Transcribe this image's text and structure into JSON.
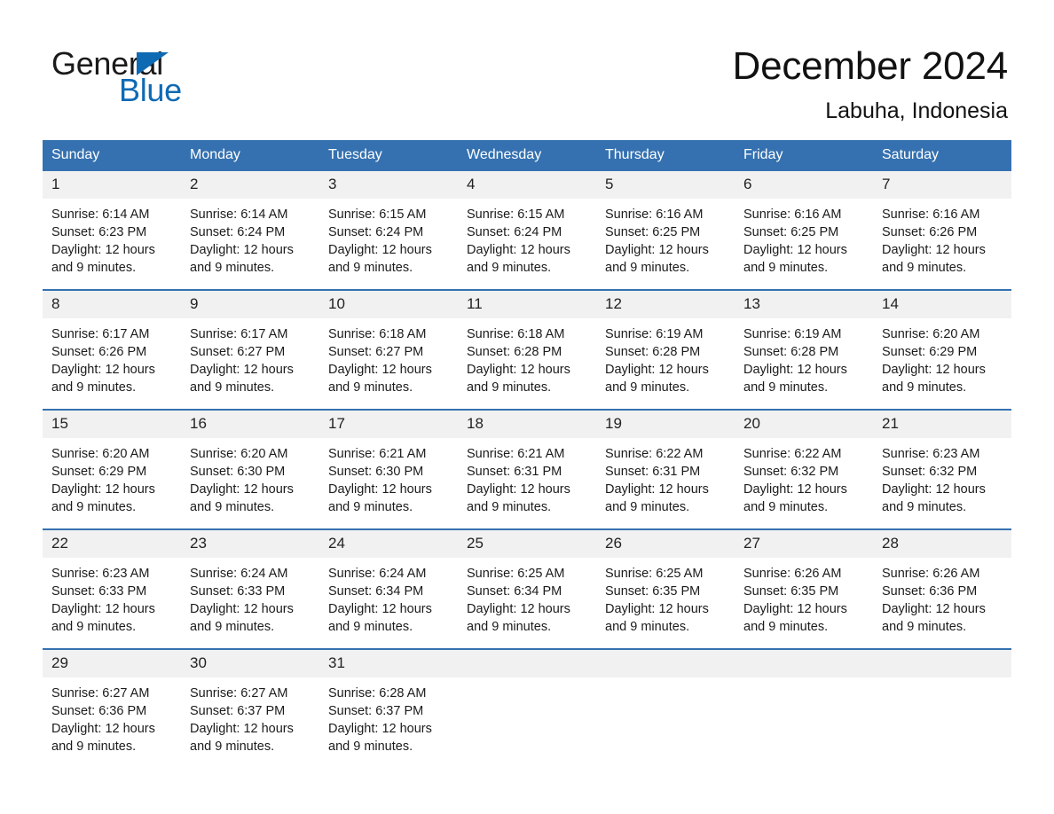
{
  "brand": {
    "name_part1": "General",
    "name_part2": "Blue",
    "triangle_color": "#0f6ab4"
  },
  "header": {
    "title": "December 2024",
    "location": "Labuha, Indonesia",
    "header_bg_color": "#3571b0",
    "daynum_bg_color": "#f1f1f1"
  },
  "weekday_headers": [
    "Sunday",
    "Monday",
    "Tuesday",
    "Wednesday",
    "Thursday",
    "Friday",
    "Saturday"
  ],
  "weeks": [
    [
      {
        "day": "1",
        "sunrise": "Sunrise: 6:14 AM",
        "sunset": "Sunset: 6:23 PM",
        "daylight_line1": "Daylight: 12 hours",
        "daylight_line2": "and 9 minutes."
      },
      {
        "day": "2",
        "sunrise": "Sunrise: 6:14 AM",
        "sunset": "Sunset: 6:24 PM",
        "daylight_line1": "Daylight: 12 hours",
        "daylight_line2": "and 9 minutes."
      },
      {
        "day": "3",
        "sunrise": "Sunrise: 6:15 AM",
        "sunset": "Sunset: 6:24 PM",
        "daylight_line1": "Daylight: 12 hours",
        "daylight_line2": "and 9 minutes."
      },
      {
        "day": "4",
        "sunrise": "Sunrise: 6:15 AM",
        "sunset": "Sunset: 6:24 PM",
        "daylight_line1": "Daylight: 12 hours",
        "daylight_line2": "and 9 minutes."
      },
      {
        "day": "5",
        "sunrise": "Sunrise: 6:16 AM",
        "sunset": "Sunset: 6:25 PM",
        "daylight_line1": "Daylight: 12 hours",
        "daylight_line2": "and 9 minutes."
      },
      {
        "day": "6",
        "sunrise": "Sunrise: 6:16 AM",
        "sunset": "Sunset: 6:25 PM",
        "daylight_line1": "Daylight: 12 hours",
        "daylight_line2": "and 9 minutes."
      },
      {
        "day": "7",
        "sunrise": "Sunrise: 6:16 AM",
        "sunset": "Sunset: 6:26 PM",
        "daylight_line1": "Daylight: 12 hours",
        "daylight_line2": "and 9 minutes."
      }
    ],
    [
      {
        "day": "8",
        "sunrise": "Sunrise: 6:17 AM",
        "sunset": "Sunset: 6:26 PM",
        "daylight_line1": "Daylight: 12 hours",
        "daylight_line2": "and 9 minutes."
      },
      {
        "day": "9",
        "sunrise": "Sunrise: 6:17 AM",
        "sunset": "Sunset: 6:27 PM",
        "daylight_line1": "Daylight: 12 hours",
        "daylight_line2": "and 9 minutes."
      },
      {
        "day": "10",
        "sunrise": "Sunrise: 6:18 AM",
        "sunset": "Sunset: 6:27 PM",
        "daylight_line1": "Daylight: 12 hours",
        "daylight_line2": "and 9 minutes."
      },
      {
        "day": "11",
        "sunrise": "Sunrise: 6:18 AM",
        "sunset": "Sunset: 6:28 PM",
        "daylight_line1": "Daylight: 12 hours",
        "daylight_line2": "and 9 minutes."
      },
      {
        "day": "12",
        "sunrise": "Sunrise: 6:19 AM",
        "sunset": "Sunset: 6:28 PM",
        "daylight_line1": "Daylight: 12 hours",
        "daylight_line2": "and 9 minutes."
      },
      {
        "day": "13",
        "sunrise": "Sunrise: 6:19 AM",
        "sunset": "Sunset: 6:28 PM",
        "daylight_line1": "Daylight: 12 hours",
        "daylight_line2": "and 9 minutes."
      },
      {
        "day": "14",
        "sunrise": "Sunrise: 6:20 AM",
        "sunset": "Sunset: 6:29 PM",
        "daylight_line1": "Daylight: 12 hours",
        "daylight_line2": "and 9 minutes."
      }
    ],
    [
      {
        "day": "15",
        "sunrise": "Sunrise: 6:20 AM",
        "sunset": "Sunset: 6:29 PM",
        "daylight_line1": "Daylight: 12 hours",
        "daylight_line2": "and 9 minutes."
      },
      {
        "day": "16",
        "sunrise": "Sunrise: 6:20 AM",
        "sunset": "Sunset: 6:30 PM",
        "daylight_line1": "Daylight: 12 hours",
        "daylight_line2": "and 9 minutes."
      },
      {
        "day": "17",
        "sunrise": "Sunrise: 6:21 AM",
        "sunset": "Sunset: 6:30 PM",
        "daylight_line1": "Daylight: 12 hours",
        "daylight_line2": "and 9 minutes."
      },
      {
        "day": "18",
        "sunrise": "Sunrise: 6:21 AM",
        "sunset": "Sunset: 6:31 PM",
        "daylight_line1": "Daylight: 12 hours",
        "daylight_line2": "and 9 minutes."
      },
      {
        "day": "19",
        "sunrise": "Sunrise: 6:22 AM",
        "sunset": "Sunset: 6:31 PM",
        "daylight_line1": "Daylight: 12 hours",
        "daylight_line2": "and 9 minutes."
      },
      {
        "day": "20",
        "sunrise": "Sunrise: 6:22 AM",
        "sunset": "Sunset: 6:32 PM",
        "daylight_line1": "Daylight: 12 hours",
        "daylight_line2": "and 9 minutes."
      },
      {
        "day": "21",
        "sunrise": "Sunrise: 6:23 AM",
        "sunset": "Sunset: 6:32 PM",
        "daylight_line1": "Daylight: 12 hours",
        "daylight_line2": "and 9 minutes."
      }
    ],
    [
      {
        "day": "22",
        "sunrise": "Sunrise: 6:23 AM",
        "sunset": "Sunset: 6:33 PM",
        "daylight_line1": "Daylight: 12 hours",
        "daylight_line2": "and 9 minutes."
      },
      {
        "day": "23",
        "sunrise": "Sunrise: 6:24 AM",
        "sunset": "Sunset: 6:33 PM",
        "daylight_line1": "Daylight: 12 hours",
        "daylight_line2": "and 9 minutes."
      },
      {
        "day": "24",
        "sunrise": "Sunrise: 6:24 AM",
        "sunset": "Sunset: 6:34 PM",
        "daylight_line1": "Daylight: 12 hours",
        "daylight_line2": "and 9 minutes."
      },
      {
        "day": "25",
        "sunrise": "Sunrise: 6:25 AM",
        "sunset": "Sunset: 6:34 PM",
        "daylight_line1": "Daylight: 12 hours",
        "daylight_line2": "and 9 minutes."
      },
      {
        "day": "26",
        "sunrise": "Sunrise: 6:25 AM",
        "sunset": "Sunset: 6:35 PM",
        "daylight_line1": "Daylight: 12 hours",
        "daylight_line2": "and 9 minutes."
      },
      {
        "day": "27",
        "sunrise": "Sunrise: 6:26 AM",
        "sunset": "Sunset: 6:35 PM",
        "daylight_line1": "Daylight: 12 hours",
        "daylight_line2": "and 9 minutes."
      },
      {
        "day": "28",
        "sunrise": "Sunrise: 6:26 AM",
        "sunset": "Sunset: 6:36 PM",
        "daylight_line1": "Daylight: 12 hours",
        "daylight_line2": "and 9 minutes."
      }
    ],
    [
      {
        "day": "29",
        "sunrise": "Sunrise: 6:27 AM",
        "sunset": "Sunset: 6:36 PM",
        "daylight_line1": "Daylight: 12 hours",
        "daylight_line2": "and 9 minutes."
      },
      {
        "day": "30",
        "sunrise": "Sunrise: 6:27 AM",
        "sunset": "Sunset: 6:37 PM",
        "daylight_line1": "Daylight: 12 hours",
        "daylight_line2": "and 9 minutes."
      },
      {
        "day": "31",
        "sunrise": "Sunrise: 6:28 AM",
        "sunset": "Sunset: 6:37 PM",
        "daylight_line1": "Daylight: 12 hours",
        "daylight_line2": "and 9 minutes."
      },
      {
        "day": "",
        "sunrise": "",
        "sunset": "",
        "daylight_line1": "",
        "daylight_line2": ""
      },
      {
        "day": "",
        "sunrise": "",
        "sunset": "",
        "daylight_line1": "",
        "daylight_line2": ""
      },
      {
        "day": "",
        "sunrise": "",
        "sunset": "",
        "daylight_line1": "",
        "daylight_line2": ""
      },
      {
        "day": "",
        "sunrise": "",
        "sunset": "",
        "daylight_line1": "",
        "daylight_line2": ""
      }
    ]
  ]
}
